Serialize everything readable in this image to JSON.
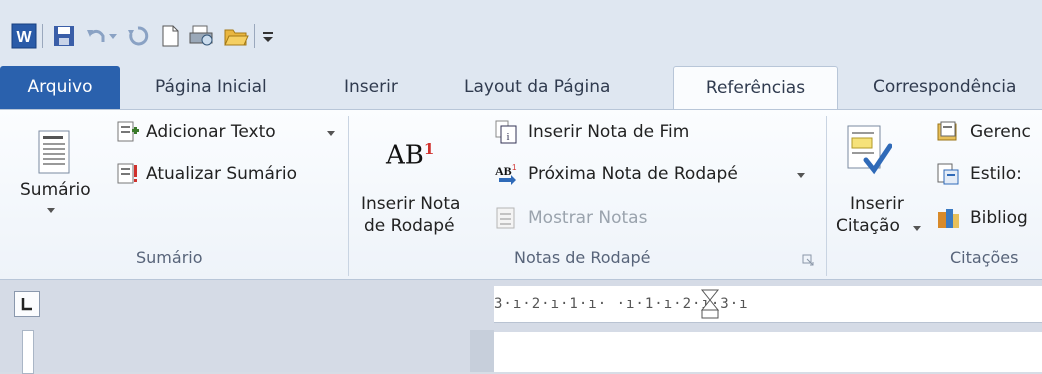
{
  "quick_access": {
    "icons": [
      "word-app-icon",
      "save-icon",
      "undo-icon",
      "redo-icon",
      "new-document-icon",
      "print-preview-icon",
      "open-folder-icon",
      "customize-toolbar-icon"
    ]
  },
  "tabs": [
    "Arquivo",
    "Página Inicial",
    "Inserir",
    "Layout da Página",
    "Referências",
    "Correspondência"
  ],
  "active_tab": "Referências",
  "ribbon": {
    "sumario": {
      "big_label": "Sumário",
      "items": [
        "Adicionar Texto",
        "Atualizar Sumário"
      ],
      "group_label": "Sumário"
    },
    "notas": {
      "big_label_1": "Inserir Nota",
      "big_label_2": "de Rodapé",
      "icon_text": "AB",
      "icon_sup": "1",
      "items": [
        "Inserir Nota de Fim",
        "Próxima Nota de Rodapé",
        "Mostrar Notas"
      ],
      "group_label": "Notas de Rodapé"
    },
    "citacoes": {
      "big_label_1": "Inserir",
      "big_label_2": "Citação",
      "items": [
        "Gerenc",
        "Estilo:",
        "Bibliog"
      ],
      "group_label": "Citações"
    }
  },
  "ruler": {
    "text": "3·ı·2·ı·1·ı·  ·ı·1·ı·2·ı·3·ı"
  },
  "colors": {
    "file_tab": "#2a61ad",
    "ribbon_bg": "#fbfdff",
    "tab_bar": "#dfe7f1"
  }
}
